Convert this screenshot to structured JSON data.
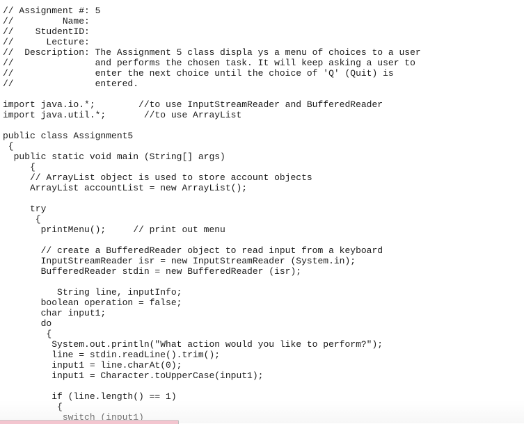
{
  "document": {
    "language": "java",
    "lines": [
      "// Assignment #: 5",
      "//         Name:",
      "//    StudentID:",
      "//      Lecture:",
      "//  Description: The Assignment 5 class displa ys a menu of choices to a user",
      "//               and performs the chosen task. It will keep asking a user to",
      "//               enter the next choice until the choice of 'Q' (Quit) is",
      "//               entered.",
      "",
      "import java.io.*;        //to use InputStreamReader and BufferedReader",
      "import java.util.*;       //to use ArrayList",
      "",
      "public class Assignment5",
      " {",
      "  public static void main (String[] args)",
      "     {",
      "     // ArrayList object is used to store account objects",
      "     ArrayList accountList = new ArrayList();",
      "",
      "     try",
      "      {",
      "       printMenu();     // print out menu",
      "",
      "       // create a BufferedReader object to read input from a keyboard",
      "       InputStreamReader isr = new InputStreamReader (System.in);",
      "       BufferedReader stdin = new BufferedReader (isr);",
      "",
      "          String line, inputInfo;",
      "       boolean operation = false;",
      "       char input1;",
      "       do",
      "        {",
      "         System.out.println(\"What action would you like to perform?\");",
      "         line = stdin.readLine().trim();",
      "         input1 = line.charAt(0);",
      "         input1 = Character.toUpperCase(input1);",
      "",
      "         if (line.length() == 1)",
      "          {",
      "           switch (input1)"
    ]
  },
  "colors": {
    "text": "#1a1a1a",
    "background": "#ffffff",
    "bottom_strip": "#f3c5cf"
  }
}
